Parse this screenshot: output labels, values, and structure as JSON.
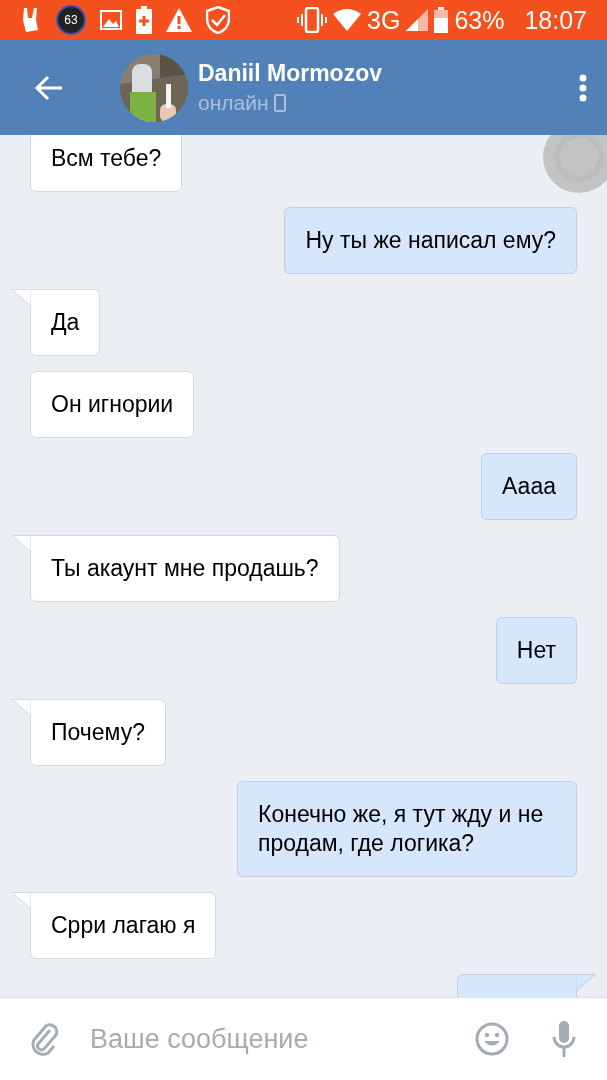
{
  "status_bar": {
    "notification_count": "63",
    "network": "3G",
    "battery": "63%",
    "time": "18:07"
  },
  "header": {
    "name": "Daniil Mormozov",
    "status": "онлайн"
  },
  "messages": [
    {
      "kind": "incoming",
      "tail": false,
      "text": "Всм тебе?"
    },
    {
      "kind": "outgoing",
      "tail": false,
      "text": "Ну ты же написал ему?"
    },
    {
      "kind": "incoming",
      "tail": true,
      "text": "Да"
    },
    {
      "kind": "incoming",
      "tail": false,
      "text": "Он игнории"
    },
    {
      "kind": "outgoing",
      "tail": false,
      "text": "Аааа"
    },
    {
      "kind": "incoming",
      "tail": true,
      "text": "Ты акаунт мне продашь?"
    },
    {
      "kind": "outgoing",
      "tail": false,
      "text": "Нет"
    },
    {
      "kind": "incoming",
      "tail": true,
      "text": "Почему?"
    },
    {
      "kind": "outgoing",
      "tail": false,
      "text": "Конечно же, я тут жду и не продам, где логика?"
    },
    {
      "kind": "incoming",
      "tail": true,
      "text": "Срри лагаю я"
    }
  ],
  "composer": {
    "placeholder": "Ваше сообщение"
  }
}
